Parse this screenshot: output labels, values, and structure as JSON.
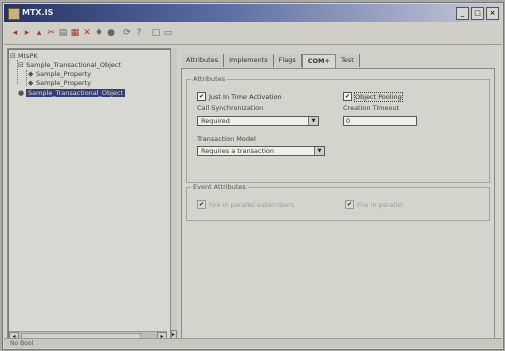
{
  "window": {
    "title": "MTX.IS",
    "buttons": [
      "_",
      "□",
      "×"
    ]
  },
  "toolbar": {
    "icons": [
      "back-icon",
      "forward-icon",
      "up-icon",
      "cut-icon",
      "copy-icon",
      "paste-icon",
      "delete-icon",
      "properties-icon",
      "view-icon",
      "refresh-icon",
      "help-icon",
      "new-icon",
      "open-icon"
    ]
  },
  "tree": {
    "root": "MtsPK",
    "component": "Sample_Transactional_Object",
    "child1": "Sample_Property",
    "child2": "Sample_Property",
    "selected": "Sample_Transactional_Object"
  },
  "tabs": [
    "Attributes",
    "Implements",
    "Flags",
    "COM+",
    "Test"
  ],
  "active_tab": "COM+",
  "attributes": {
    "group_title": "Attributes",
    "jit_label": "Just In Time Activation",
    "jit_checked": true,
    "object_pooling_label": "Object Pooling",
    "object_pooling_checked": true,
    "sync_label": "Call Synchronization",
    "sync_value": "Required",
    "creation_timeout_label": "Creation Timeout",
    "creation_timeout_value": "0",
    "tx_model_label": "Transaction Model",
    "tx_model_value": "Requires a transaction"
  },
  "events": {
    "group_title": "Event Attributes",
    "item1": "Fire in parallel subscribers",
    "item2": "Fire in parallel"
  },
  "status": "No Bool"
}
